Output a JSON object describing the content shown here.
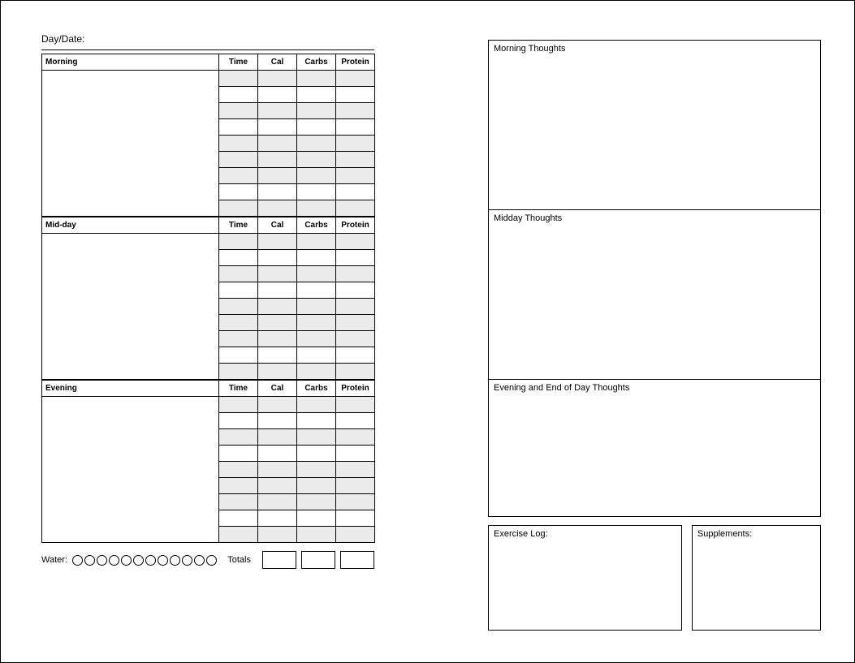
{
  "daydate_label": "Day/Date:",
  "sections": {
    "morning": {
      "title": "Morning",
      "cols": [
        "Time",
        "Cal",
        "Carbs",
        "Protein"
      ]
    },
    "midday": {
      "title": "Mid-day",
      "cols": [
        "Time",
        "Cal",
        "Carbs",
        "Protein"
      ]
    },
    "evening": {
      "title": "Evening",
      "cols": [
        "Time",
        "Cal",
        "Carbs",
        "Protein"
      ]
    }
  },
  "water_label": "Water:",
  "water_count": 12,
  "totals_label": "Totals",
  "thoughts": {
    "morning": "Morning Thoughts",
    "midday": "Midday Thoughts",
    "evening": "Evening and End of Day Thoughts",
    "exercise": "Exercise Log:",
    "supplements": "Supplements:"
  }
}
